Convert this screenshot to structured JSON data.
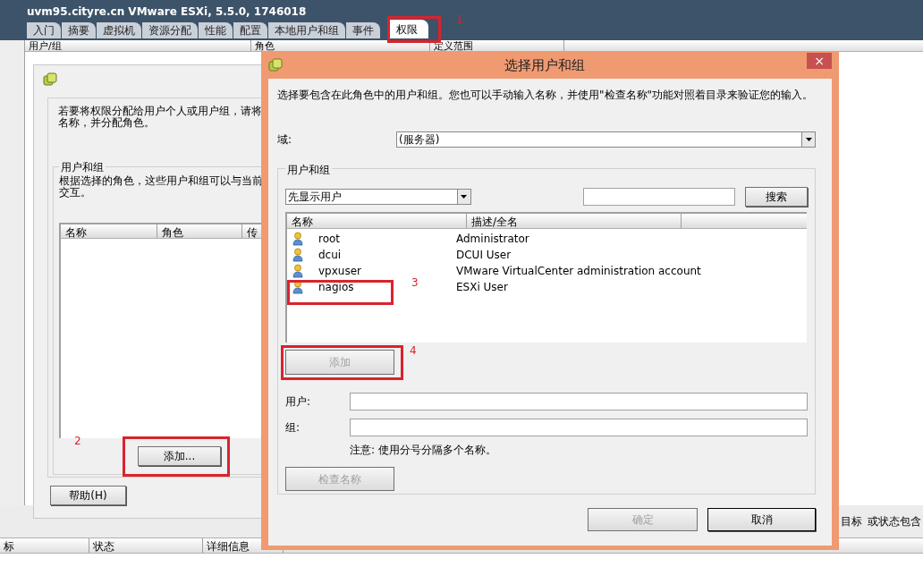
{
  "window": {
    "title": "uvm95.cityre.cn VMware ESXi, 5.5.0, 1746018"
  },
  "tabs": [
    {
      "label": "入门",
      "selected": false
    },
    {
      "label": "摘要",
      "selected": false
    },
    {
      "label": "虚拟机",
      "selected": false
    },
    {
      "label": "资源分配",
      "selected": false
    },
    {
      "label": "性能",
      "selected": false
    },
    {
      "label": "配置",
      "selected": false
    },
    {
      "label": "本地用户和组",
      "selected": false
    },
    {
      "label": "事件",
      "selected": false
    },
    {
      "label": "权限",
      "selected": true
    }
  ],
  "permissions_table": {
    "columns": [
      "用户/组",
      "角色",
      "定义范围"
    ]
  },
  "assign_dialog": {
    "intro": [
      "若要将权限分配给用户个人或用户组，请将",
      "名称，并分配角色。"
    ],
    "group_title": "用户和组",
    "group_text": [
      "根据选择的角色，这些用户和组可以与当前",
      "交互。"
    ],
    "columns": [
      "名称",
      "角色",
      "传"
    ],
    "add_button": "添加...",
    "help_button": "帮助(H)"
  },
  "select_dialog": {
    "title": "选择用户和组",
    "close": "×",
    "intro": "选择要包含在此角色中的用户和组。您也可以手动输入名称，并使用\"检查名称\"功能对照着目录来验证您的输入。",
    "domain_label": "域:",
    "domain_value": "(服务器)",
    "group_title": "用户和组",
    "filter_value": "先显示用户",
    "search_button": "搜索",
    "columns": [
      "名称",
      "描述/全名"
    ],
    "rows": [
      {
        "name": "root",
        "description": "Administrator",
        "selected": false
      },
      {
        "name": "dcui",
        "description": "DCUI User",
        "selected": false
      },
      {
        "name": "vpxuser",
        "description": "VMware VirtualCenter administration account",
        "selected": false
      },
      {
        "name": "nagios",
        "description": "ESXi User",
        "selected": false
      }
    ],
    "add_button": {
      "label": "添加",
      "disabled": true
    },
    "user_label": "用户:",
    "group_label": "组:",
    "note": "注意: 使用分号分隔多个名称。",
    "check_button": {
      "label": "检查名称",
      "disabled": true
    },
    "ok_button": {
      "label": "确定",
      "disabled": true
    },
    "cancel_button": {
      "label": "取消",
      "disabled": false
    }
  },
  "filter_bar": {
    "texts": [
      "目标",
      "或状态包含"
    ]
  },
  "tasks_table": {
    "columns": [
      "标",
      "状态",
      "详细信息"
    ]
  },
  "annotations": [
    {
      "label": "1"
    },
    {
      "label": "2"
    },
    {
      "label": "3"
    },
    {
      "label": "4"
    }
  ]
}
